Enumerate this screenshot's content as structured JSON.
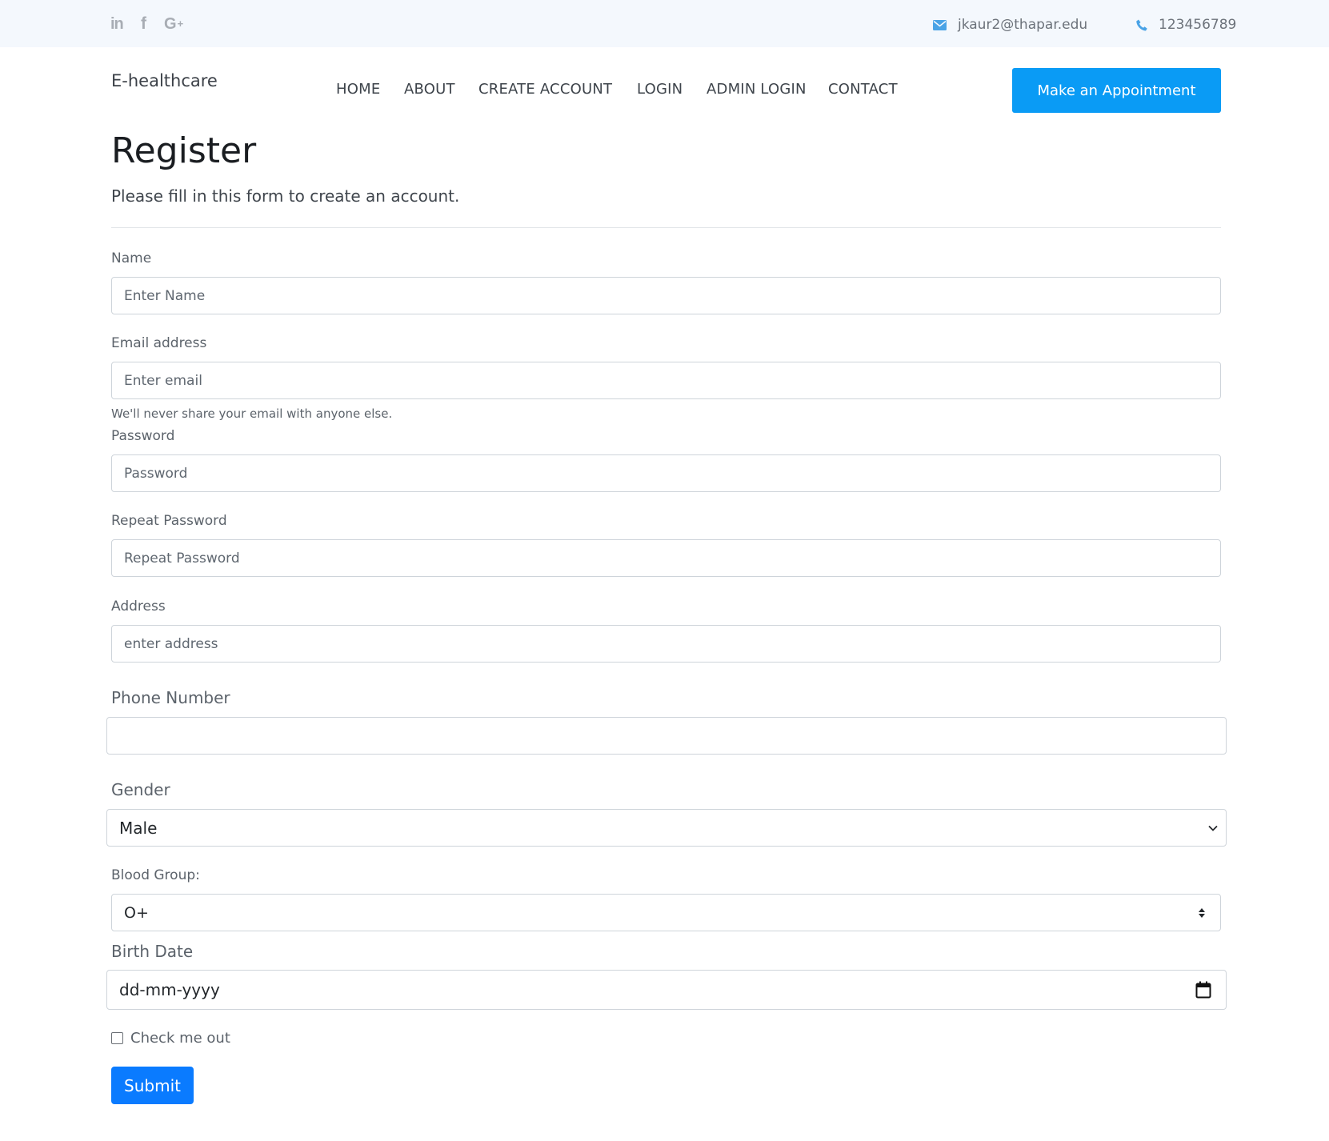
{
  "topbar": {
    "social": {
      "linkedin": "in",
      "facebook": "f",
      "googleplus": "G",
      "googleplus_plus": "+"
    },
    "email": "jkaur2@thapar.edu",
    "phone": "123456789"
  },
  "header": {
    "brand": "E-healthcare",
    "nav": [
      "HOME",
      "ABOUT",
      "CREATE ACCOUNT",
      "LOGIN",
      "ADMIN LOGIN",
      "CONTACT"
    ],
    "cta": "Make an Appointment"
  },
  "form": {
    "title": "Register",
    "subtitle": "Please fill in this form to create an account.",
    "name": {
      "label": "Name",
      "placeholder": "Enter Name"
    },
    "email": {
      "label": "Email address",
      "placeholder": "Enter email",
      "help": "We'll never share your email with anyone else."
    },
    "password": {
      "label": "Password",
      "placeholder": "Password"
    },
    "repeat_password": {
      "label": "Repeat Password",
      "placeholder": "Repeat Password"
    },
    "address": {
      "label": "Address",
      "placeholder": "enter address"
    },
    "phone": {
      "label": "Phone Number",
      "value": ""
    },
    "gender": {
      "label": "Gender",
      "selected": "Male"
    },
    "blood_group": {
      "label": "Blood Group:",
      "selected": "O+"
    },
    "birth_date": {
      "label": "Birth Date",
      "placeholder": "dd-mm-yyyy"
    },
    "check_label": "Check me out",
    "submit": "Submit"
  },
  "colors": {
    "accent": "#0a9bf5",
    "submit": "#0a7bff",
    "topbar_bg": "#f4f8fd"
  }
}
